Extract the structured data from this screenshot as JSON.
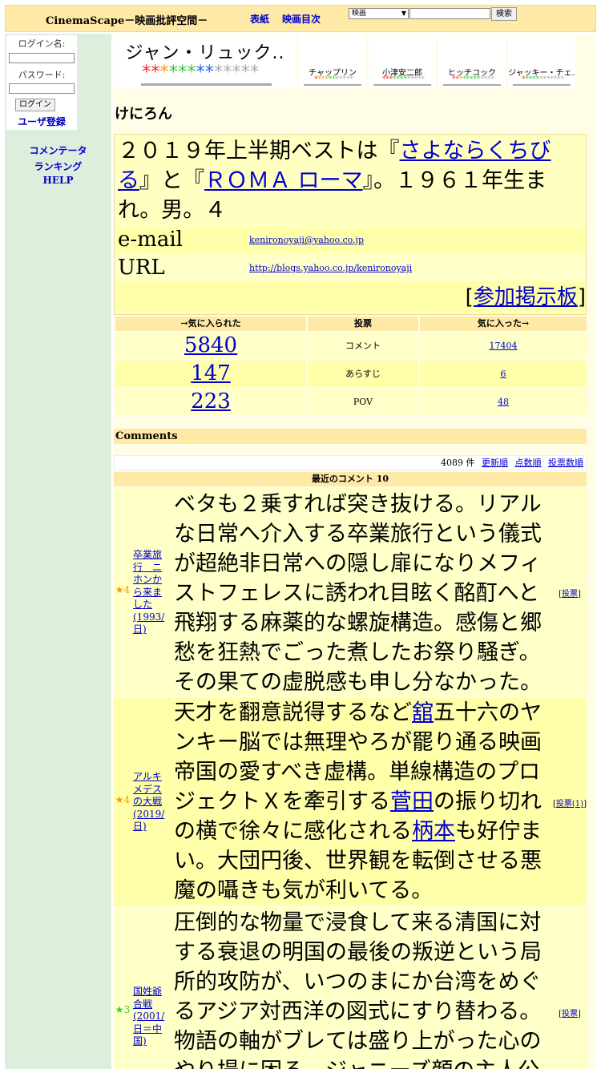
{
  "header": {
    "site_title": "CinemaScape－映画批評空間－",
    "nav_cover": "表紙",
    "nav_index": "映画目次",
    "search_category": "映画",
    "search_button": "検索"
  },
  "sidebar": {
    "login_label": "ログイン名:",
    "password_label": "パスワード:",
    "login_button": "ログイン",
    "register_link": "ユーザ登録",
    "links": [
      "コメンテータ",
      "ランキング",
      "HELP"
    ]
  },
  "user": {
    "name_top": "ジャン・リュック..",
    "nickname": "けにろん"
  },
  "similar": [
    {
      "name": "チャップリン"
    },
    {
      "name": "小津安二郎"
    },
    {
      "name": "ヒッチコック"
    },
    {
      "name": "ジャッキー・チェ.."
    }
  ],
  "profile": {
    "intro_1": "２０１９年上半期ベストは『",
    "intro_link_1": "さよならくちびる",
    "intro_2": "』と『",
    "intro_link_2": "ＲＯＭＡ ローマ",
    "intro_3": "』。１９６１年生まれ。男。４",
    "email_label": "e-mail",
    "email_value": "kenironoyaji@yahoo.co.jp",
    "url_label": "URL",
    "url_value": "http://blogs.yahoo.co.jp/kenironoyaji",
    "board_open": "[",
    "board_link": "参加掲示板",
    "board_close": "]"
  },
  "stats": {
    "head_favored": "→気に入られた",
    "head_vote": "投票",
    "head_favorite": "気に入った→",
    "rows": [
      {
        "favored": "5840",
        "label": "コメント",
        "favorite": "17404"
      },
      {
        "favored": "147",
        "label": "あらすじ",
        "favorite": "6"
      },
      {
        "favored": "223",
        "label": "POV",
        "favorite": "48"
      }
    ]
  },
  "comments": {
    "section_title": "Comments",
    "count": "4089 件",
    "sort_updated": "更新順",
    "sort_score": "点数順",
    "sort_votes": "投票数順",
    "recent_title": "最近のコメント 10",
    "items": [
      {
        "stars": "4",
        "title": "卒業旅行　ニホンから来ました(1993/日)",
        "body": "ベタも２乗すれば突き抜ける。リアルな日常へ介入する卒業旅行という儀式が超絶非日常への隠し扉になりメフィストフェレスに誘われ目眩く酩酊へと飛翔する麻薬的な螺旋構造。感傷と郷愁を狂熱でごった煮したお祭り騒ぎ。その果ての虚脱感も申し分なかった。",
        "vote": "投票"
      },
      {
        "stars": "4",
        "title": "アルキメデスの大戦(2019/日)",
        "body_1": "天才を翻意説得するなど",
        "link_1": "舘",
        "body_2": "五十六のヤンキー脳では無理やろが罷り通る映画帝国の愛すべき虚構。単線構造のプロジェクトＸを牽引する",
        "link_2": "菅田",
        "body_3": "の振り切れの横で徐々に感化される",
        "link_3": "柄本",
        "body_4": "も好佇まい。大団円後、世界観を転倒させる悪魔の囁きも気が利いてる。",
        "vote": "投票(1)"
      },
      {
        "stars": "3",
        "title": "国姓爺合戦(2001/日＝中国)",
        "body": "圧倒的な物量で浸食して来る清国に対する衰退の明国の最後の叛逆という局所的攻防が、いつのまにか台湾をめぐるアジア対西洋の図式にすり替わる。物語の軸がブレては盛り上がった心のやり場に困る。ジャニーズ顔の主人公",
        "vote": "投票"
      }
    ]
  },
  "colors": {
    "header_bg": "#ffe9a6",
    "sidebar_bg": "#ddeedd",
    "link": "#0000cc",
    "star_red": "#ff2222",
    "star_orange": "#ff9900",
    "star_green": "#33cc33",
    "star_blue": "#2266ff",
    "star_gray": "#aaaaaa"
  }
}
